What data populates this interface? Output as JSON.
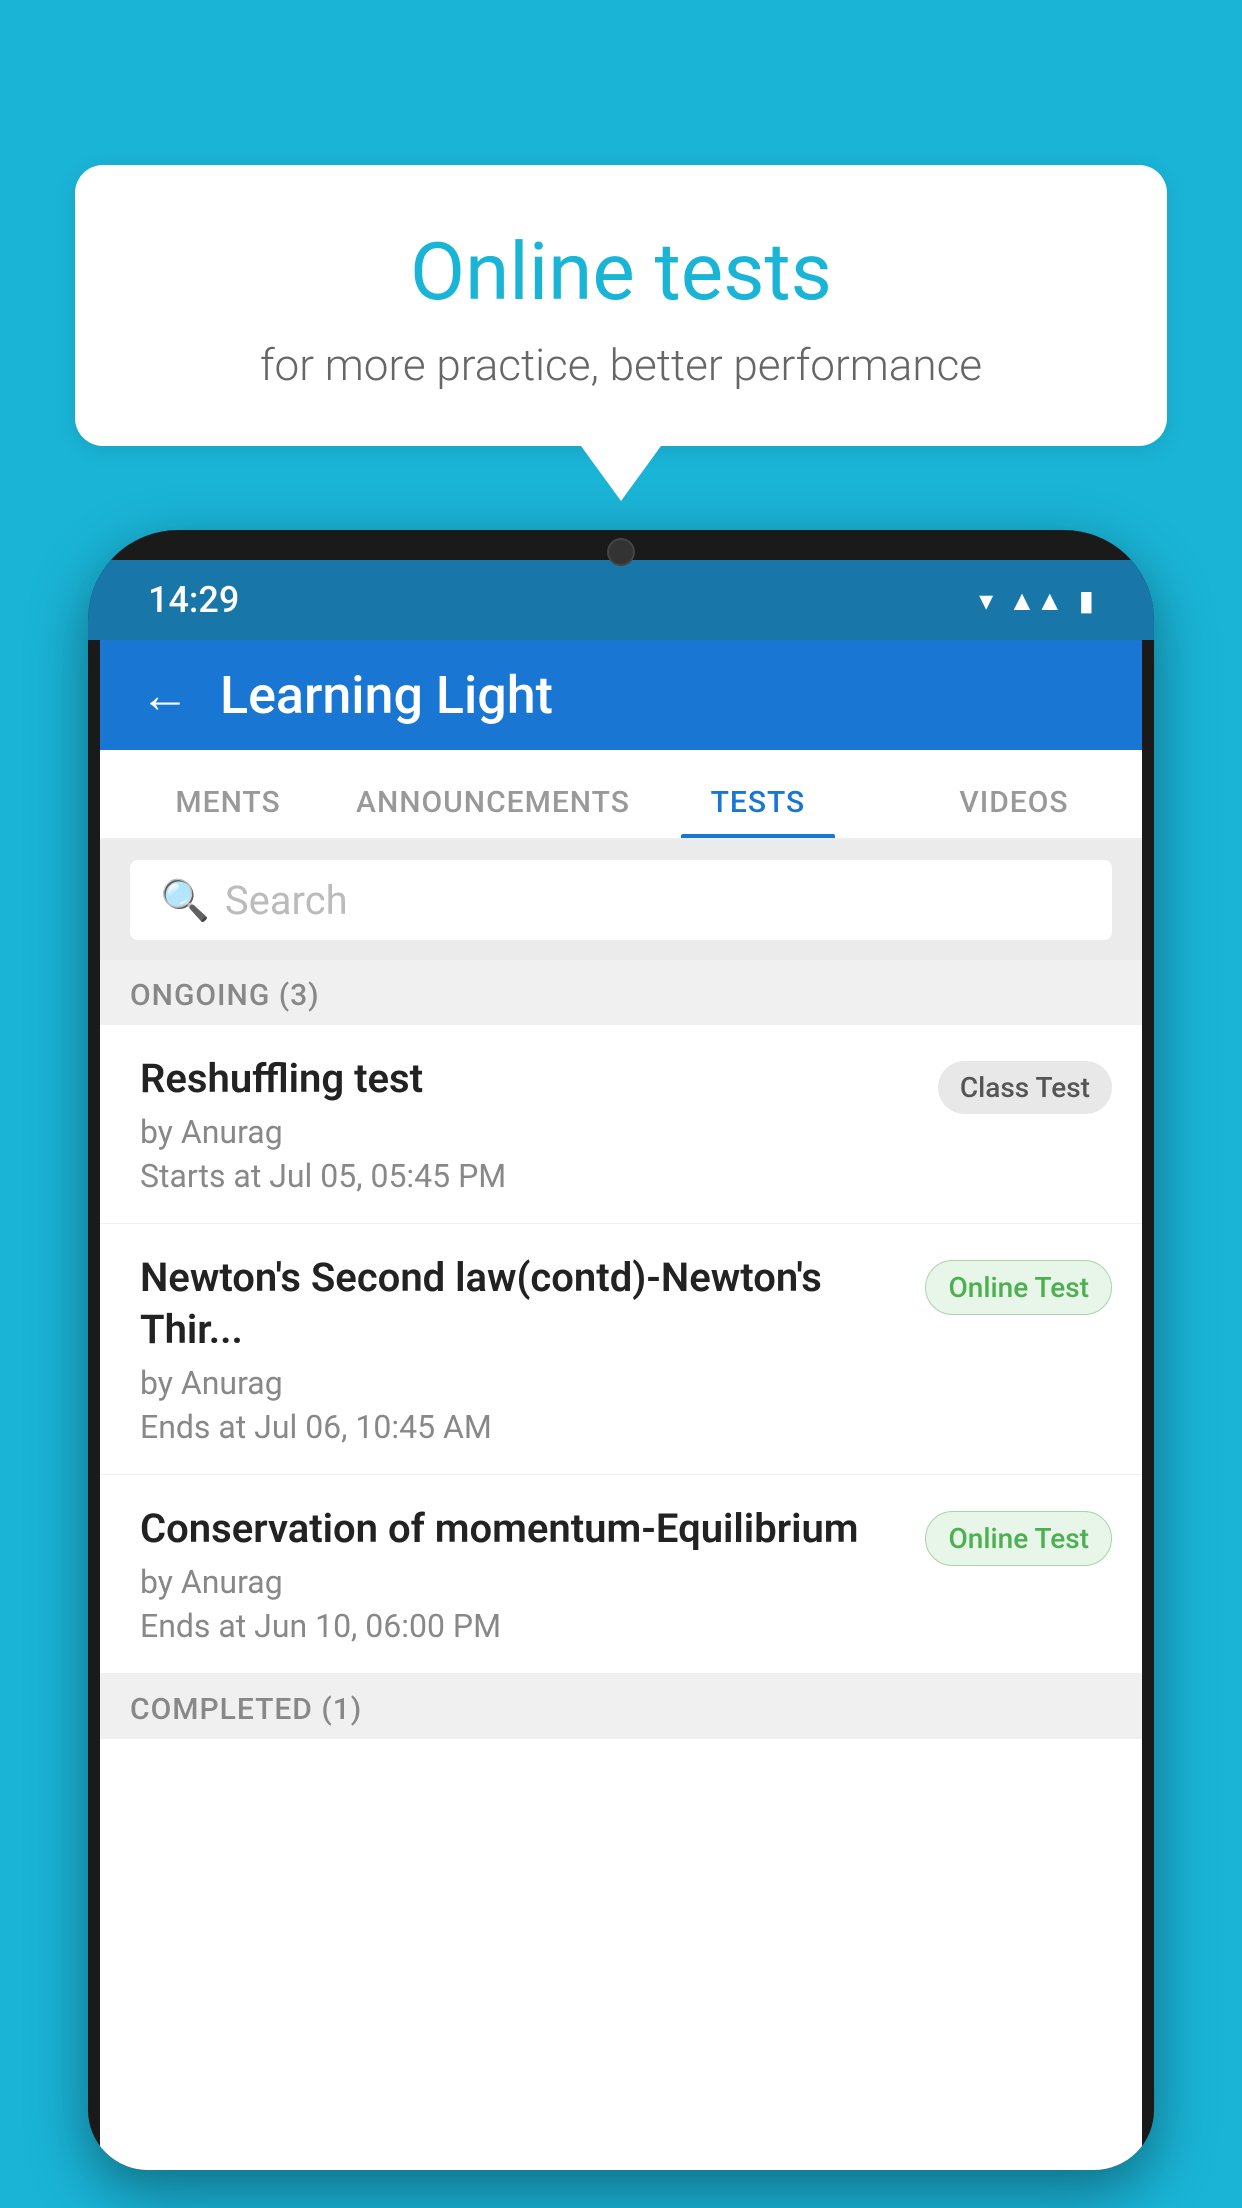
{
  "background": {
    "color": "#1ab4d7"
  },
  "speech_bubble": {
    "title": "Online tests",
    "subtitle": "for more practice, better performance"
  },
  "phone": {
    "status_bar": {
      "time": "14:29",
      "icons": [
        "wifi",
        "signal",
        "battery"
      ]
    },
    "app_bar": {
      "back_label": "←",
      "title": "Learning Light"
    },
    "tabs": [
      {
        "label": "MENTS",
        "active": false
      },
      {
        "label": "ANNOUNCEMENTS",
        "active": false
      },
      {
        "label": "TESTS",
        "active": true
      },
      {
        "label": "VIDEOS",
        "active": false
      }
    ],
    "search": {
      "placeholder": "Search"
    },
    "sections": [
      {
        "label": "ONGOING (3)",
        "tests": [
          {
            "title": "Reshuffling test",
            "author": "by Anurag",
            "date": "Starts at  Jul 05, 05:45 PM",
            "badge": "Class Test",
            "badge_type": "class"
          },
          {
            "title": "Newton's Second law(contd)-Newton's Thir...",
            "author": "by Anurag",
            "date": "Ends at  Jul 06, 10:45 AM",
            "badge": "Online Test",
            "badge_type": "online"
          },
          {
            "title": "Conservation of momentum-Equilibrium",
            "author": "by Anurag",
            "date": "Ends at  Jun 10, 06:00 PM",
            "badge": "Online Test",
            "badge_type": "online"
          }
        ]
      },
      {
        "label": "COMPLETED (1)",
        "tests": []
      }
    ]
  }
}
